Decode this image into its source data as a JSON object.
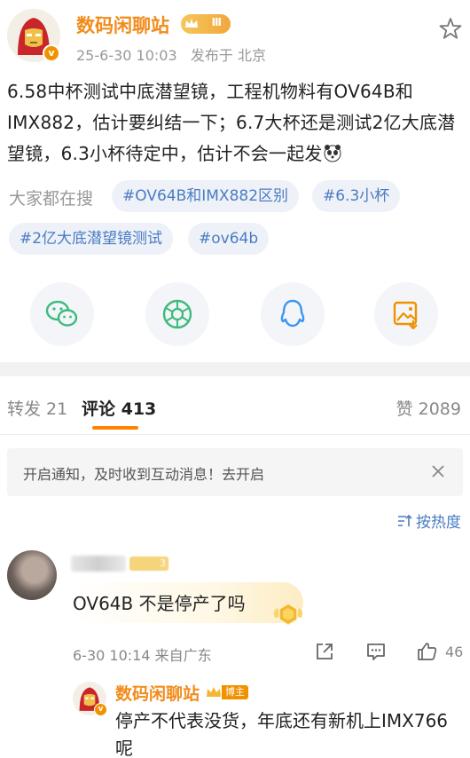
{
  "post": {
    "author": "数码闲聊站",
    "rank": "Ⅲ",
    "verified_mark": "v",
    "time": "25-6-30 10:03",
    "location": "发布于 北京",
    "text": "6.58中杯测试中底潜望镜，工程机物料有OV64B和IMX882，估计要纠结一下；6.7大杯还是测试2亿大底潜望镜，6.3小杯待定中，估计不会一起发"
  },
  "tags": {
    "label": "大家都在搜",
    "items": [
      "#OV64B和IMX882区别",
      "#6.3小杯",
      "#2亿大底潜望镜测试",
      "#ov64b"
    ]
  },
  "share": [
    "wechat-icon",
    "moments-icon",
    "qq-icon",
    "save-image-icon"
  ],
  "tabs": {
    "repost": "转发 21",
    "comments": "评论 413",
    "likes": "赞 2089"
  },
  "notice": {
    "text": "开启通知，及时收到互动消息！去开启"
  },
  "sort": {
    "label": "按热度"
  },
  "comment": {
    "level": "3",
    "text": "OV64B 不是停产了吗",
    "meta": "6-30 10:14  来自广东",
    "likes": "46"
  },
  "reply": {
    "author": "数码闲聊站",
    "badge": "博主",
    "verified_mark": "v",
    "text": "停产不代表没货，年底还有新机上IMX766呢"
  },
  "colors": {
    "brand_orange": "#f28b1b",
    "link_blue": "#4a7cc2",
    "accent": "#ff8200"
  }
}
